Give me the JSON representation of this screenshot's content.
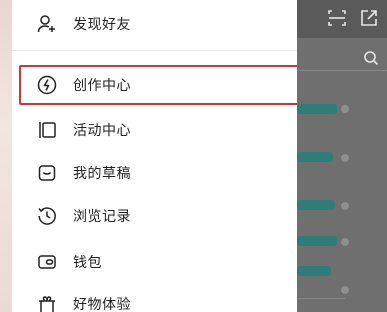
{
  "menu": {
    "items": [
      {
        "label": "发现好友",
        "icon": "add-friend-icon"
      },
      {
        "label": "创作中心",
        "icon": "lightning-icon"
      },
      {
        "label": "活动中心",
        "icon": "activity-icon"
      },
      {
        "label": "我的草稿",
        "icon": "draft-icon"
      },
      {
        "label": "浏览记录",
        "icon": "history-icon"
      },
      {
        "label": "钱包",
        "icon": "wallet-icon"
      },
      {
        "label": "好物体验",
        "icon": "gift-icon"
      }
    ],
    "highlighted": "创作中心"
  },
  "background_app": {
    "icons": [
      "scan-icon",
      "share-icon",
      "search-icon"
    ]
  },
  "colors": {
    "highlight_border": "#d9342b",
    "overlay": "#6f6f6f",
    "bubble": "#2f7c78"
  }
}
